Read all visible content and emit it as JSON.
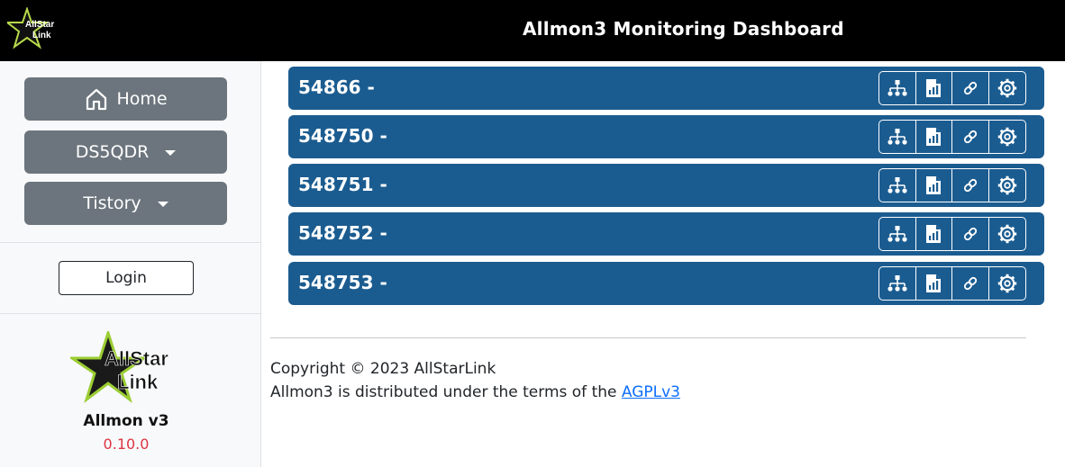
{
  "header": {
    "logo_text_line1": "AllStar",
    "logo_text_line2": "Link",
    "title": "Allmon3 Monitoring Dashboard"
  },
  "sidebar": {
    "home_label": "Home",
    "menu1_label": "DS5QDR",
    "menu2_label": "Tistory",
    "login_label": "Login",
    "logo_text_line1": "AllStar",
    "logo_text_line2": "Link",
    "app_name": "Allmon v3",
    "version": "0.10.0"
  },
  "nodes": [
    {
      "label": "54866 -"
    },
    {
      "label": "548750 -"
    },
    {
      "label": "548751 -"
    },
    {
      "label": "548752 -"
    },
    {
      "label": "548753 -"
    }
  ],
  "node_buttons": [
    "network-icon",
    "file-chart-icon",
    "link-icon",
    "gear-icon"
  ],
  "footer": {
    "copyright": "Copyright © 2023 AllStarLink",
    "license_prefix": "Allmon3 is distributed under the terms of the ",
    "license_link": "AGPLv3"
  },
  "colors": {
    "header_bg": "#000000",
    "node_bar": "#1b5c90",
    "sidebar_btn": "#6c757d",
    "version_text": "#dc3545",
    "link": "#0d6efd"
  }
}
